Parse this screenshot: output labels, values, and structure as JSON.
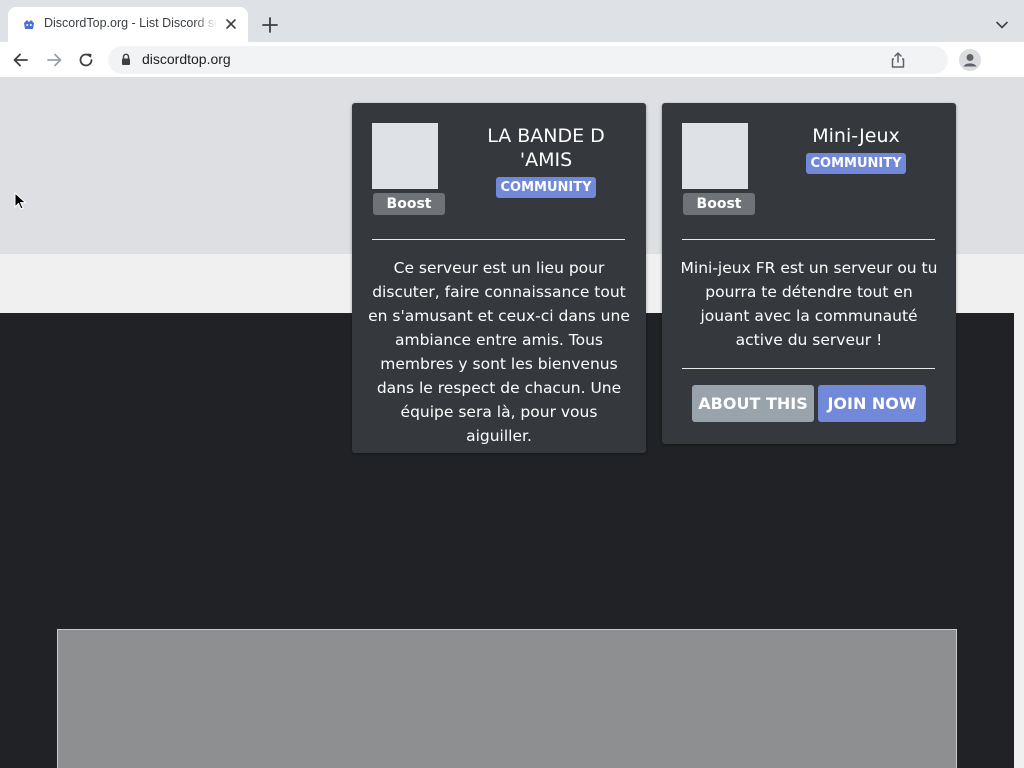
{
  "browser": {
    "tab_title": "DiscordTop.org - List Discord servers",
    "url": "discordtop.org"
  },
  "cards": [
    {
      "title_line1": "LA BANDE D",
      "title_line2": "'AMIS",
      "tag": "COMMUNITY",
      "boost_label": "Boost",
      "description_lines": [
        "Ce serveur est un lieu pour",
        "discuter, faire connaissance tout",
        "en s'amusant et ceux-ci dans une",
        "ambiance entre amis. Tous",
        "membres y sont les bienvenus",
        "dans le respect de chacun. Une",
        "équipe sera là, pour vous",
        "aiguiller."
      ]
    },
    {
      "title": "Mini-Jeux",
      "tag": "COMMUNITY",
      "boost_label": "Boost",
      "description_lines": [
        "Mini-jeux FR est un serveur ou tu",
        "pourra te détendre tout en",
        "jouant avec la communauté",
        "active du serveur !"
      ],
      "about_label": "ABOUT THIS",
      "join_label": "JOIN NOW"
    }
  ],
  "colors": {
    "card_bg": "#35383d",
    "tag_bg": "#7289da",
    "join_bg": "#7289da",
    "about_bg": "#99a3ab",
    "page_dark": "#202225"
  }
}
